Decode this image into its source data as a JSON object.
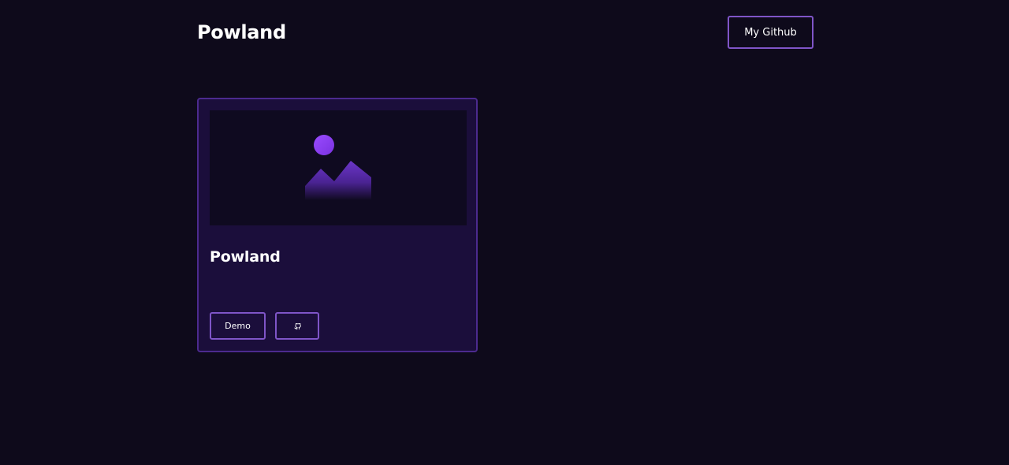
{
  "header": {
    "title": "Powland",
    "github_label": "My Github"
  },
  "projects": [
    {
      "title": "Powland",
      "image_icon": "image-placeholder-icon",
      "demo_label": "Demo",
      "repo_icon": "github-octocat-icon"
    }
  ],
  "colors": {
    "background": "#0e0a1b",
    "card_background": "#1b0e3b",
    "card_border": "#4c2a8f",
    "button_border": "#7f55c8",
    "accent": "#8b3ff0"
  }
}
